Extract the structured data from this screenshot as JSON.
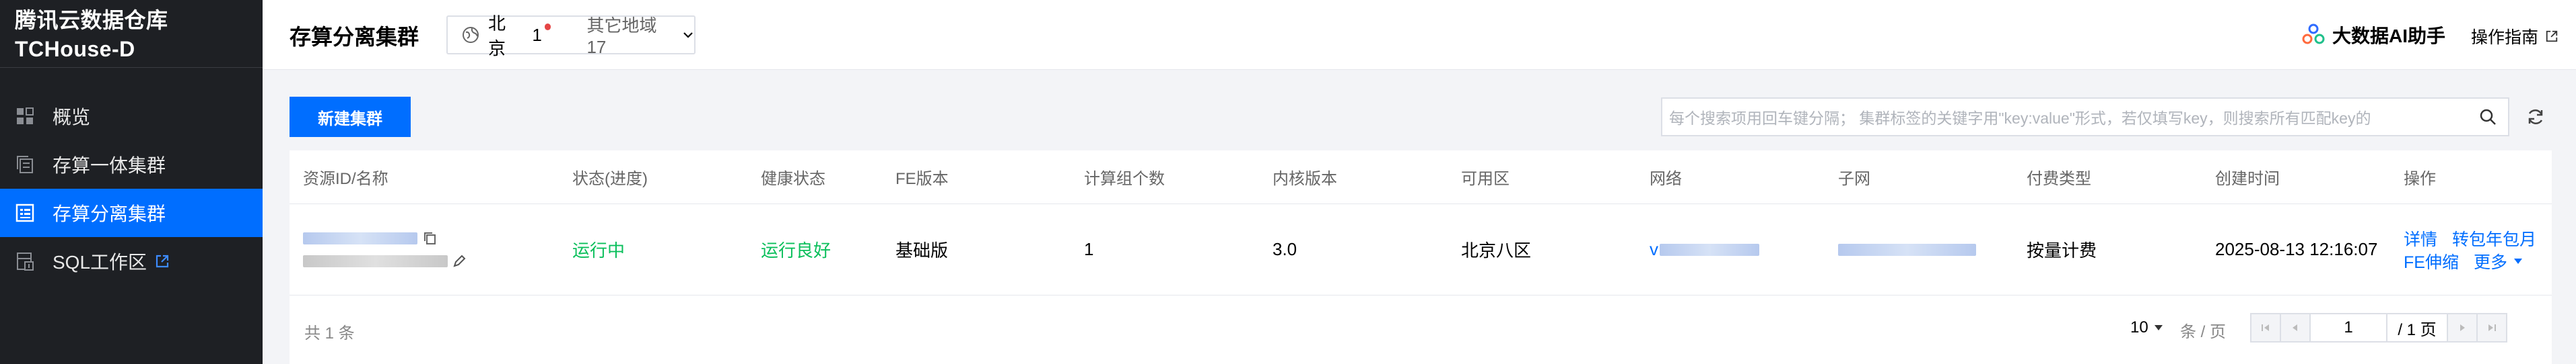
{
  "sidebar": {
    "brand_line1": "腾讯云数据仓库",
    "brand_line2": "TCHouse-D",
    "items": [
      {
        "label": "概览",
        "icon": "grid-icon"
      },
      {
        "label": "存算一体集群",
        "icon": "copy-icon"
      },
      {
        "label": "存算分离集群",
        "icon": "list-box-icon",
        "active": true
      },
      {
        "label": "SQL工作区",
        "icon": "database-icon",
        "external": true
      }
    ]
  },
  "header": {
    "title": "存算分离集群",
    "region": "北京",
    "region_count": "1",
    "other_regions": "其它地域 17",
    "ai_assistant": "大数据AI助手",
    "guide": "操作指南"
  },
  "toolbar": {
    "new_cluster": "新建集群",
    "search_placeholder": "每个搜索项用回车键分隔；  集群标签的关键字用\"key:value\"形式，若仅填写key，则搜索所有匹配key的"
  },
  "table": {
    "columns": [
      "资源ID/名称",
      "状态(进度)",
      "健康状态",
      "FE版本",
      "计算组个数",
      "内核版本",
      "可用区",
      "网络",
      "子网",
      "付费类型",
      "创建时间",
      "操作"
    ],
    "rows": [
      {
        "status": "运行中",
        "health": "运行良好",
        "fe_version": "基础版",
        "compute_groups": "1",
        "kernel_version": "3.0",
        "zone": "北京八区",
        "network_prefix": "v",
        "billing": "按量计费",
        "created": "2025-08-13 12:16:07",
        "actions": {
          "detail": "详情",
          "convert": "转包年包月",
          "scale": "FE伸缩",
          "more": "更多"
        }
      }
    ]
  },
  "footer": {
    "total": "共 1 条",
    "page_size": "10",
    "page_size_unit": "条 / 页",
    "page": "1",
    "page_total": "/ 1 页"
  },
  "colors": {
    "primary": "#006eff",
    "sidebar_bg": "#1e2024",
    "success": "#0abf5b"
  }
}
